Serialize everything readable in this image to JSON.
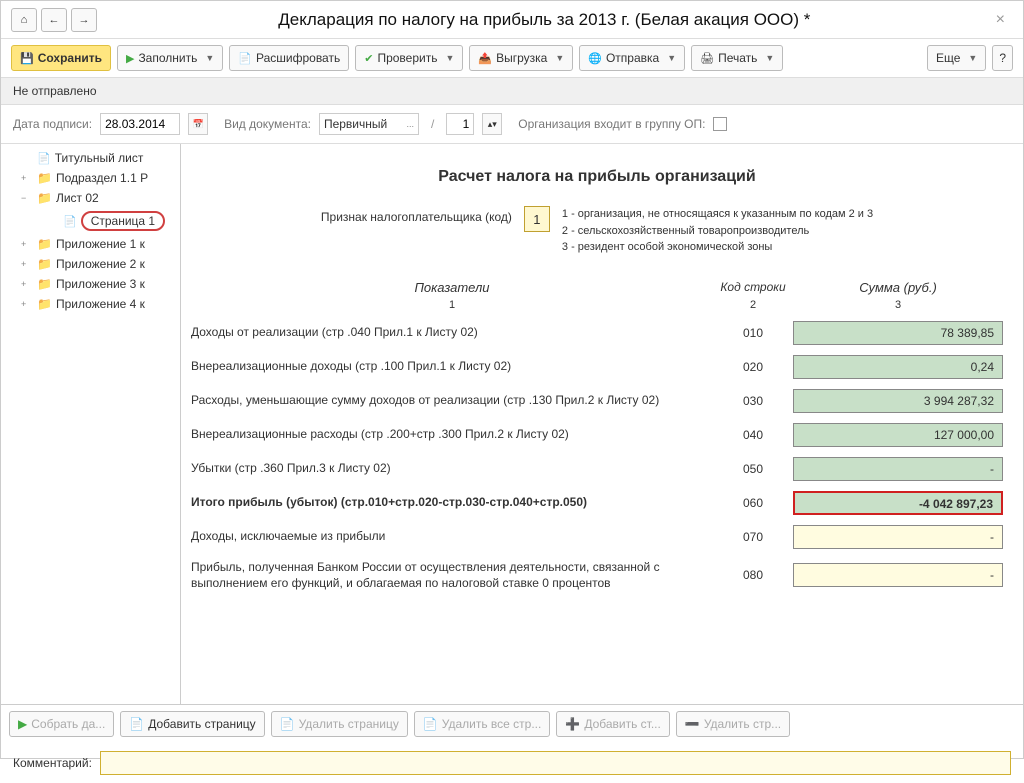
{
  "header": {
    "title": "Декларация по налогу на прибыль за 2013 г. (Белая акация ООО) *"
  },
  "toolbar": {
    "save": "Сохранить",
    "fill": "Заполнить",
    "decrypt": "Расшифровать",
    "check": "Проверить",
    "export": "Выгрузка",
    "send": "Отправка",
    "print": "Печать",
    "more": "Еще"
  },
  "status": "Не отправлено",
  "params": {
    "date_label": "Дата подписи:",
    "date_value": "28.03.2014",
    "doc_type_label": "Вид документа:",
    "doc_type_value": "Первичный",
    "page_sep": "/",
    "page_value": "1",
    "org_group_label": "Организация входит в группу ОП:"
  },
  "tree": {
    "items": [
      {
        "label": "Титульный лист",
        "type": "doc",
        "level": 1
      },
      {
        "label": "Подраздел 1.1 Р",
        "type": "folder",
        "level": 1,
        "exp": "+"
      },
      {
        "label": "Лист 02",
        "type": "folder",
        "level": 1,
        "exp": "−",
        "open": true
      },
      {
        "label": "Страница 1",
        "type": "doc",
        "level": 2,
        "selected": true
      },
      {
        "label": "Приложение 1 к",
        "type": "folder",
        "level": 1,
        "exp": "+"
      },
      {
        "label": "Приложение 2 к",
        "type": "folder",
        "level": 1,
        "exp": "+"
      },
      {
        "label": "Приложение 3 к",
        "type": "folder",
        "level": 1,
        "exp": "+"
      },
      {
        "label": "Приложение 4 к",
        "type": "folder",
        "level": 1,
        "exp": "+"
      }
    ]
  },
  "content": {
    "title": "Расчет налога на прибыль организаций",
    "taxpayer_label": "Признак налогоплательщика (код)",
    "taxpayer_code": "1",
    "legend": {
      "l1": "1 - организация, не относящаяся к указанным по кодам 2 и 3",
      "l2": "2 - сельскохозяйственный товаропроизводитель",
      "l3": "3 - резидент особой экономической зоны"
    },
    "cols": {
      "c1": "Показатели",
      "c2": "Код строки",
      "c3": "Сумма (руб.)",
      "n1": "1",
      "n2": "2",
      "n3": "3"
    },
    "rows": [
      {
        "label": "Доходы от реализации (стр .040 Прил.1 к Листу 02)",
        "code": "010",
        "value": "78 389,85",
        "style": "green"
      },
      {
        "label": "Внереализационные доходы (стр .100 Прил.1 к Листу 02)",
        "code": "020",
        "value": "0,24",
        "style": "green"
      },
      {
        "label": "Расходы, уменьшающие сумму доходов от реализации (стр .130 Прил.2 к Листу 02)",
        "code": "030",
        "value": "3 994 287,32",
        "style": "green"
      },
      {
        "label": "Внереализационные расходы (стр .200+стр .300 Прил.2 к Листу 02)",
        "code": "040",
        "value": "127 000,00",
        "style": "green"
      },
      {
        "label": "Убытки (стр .360 Прил.3 к Листу 02)",
        "code": "050",
        "value": "-",
        "style": "green"
      },
      {
        "label": "Итого прибыль (убыток)        (стр.010+стр.020-стр.030-стр.040+стр.050)",
        "code": "060",
        "value": "-4 042 897,23",
        "style": "red",
        "bold": true
      },
      {
        "label": "Доходы, исключаемые из прибыли",
        "code": "070",
        "value": "-",
        "style": "yellow"
      },
      {
        "label": "Прибыль, полученная Банком России от осуществления деятельности, связанной с выполнением его функций, и облагаемая по налоговой ставке 0 процентов",
        "code": "080",
        "value": "-",
        "style": "yellow"
      }
    ]
  },
  "bottom": {
    "collect": "Собрать да...",
    "add_page": "Добавить страницу",
    "del_page": "Удалить страницу",
    "del_all": "Удалить все стр...",
    "add_str": "Добавить ст...",
    "del_str": "Удалить стр..."
  },
  "comment_label": "Комментарий:"
}
